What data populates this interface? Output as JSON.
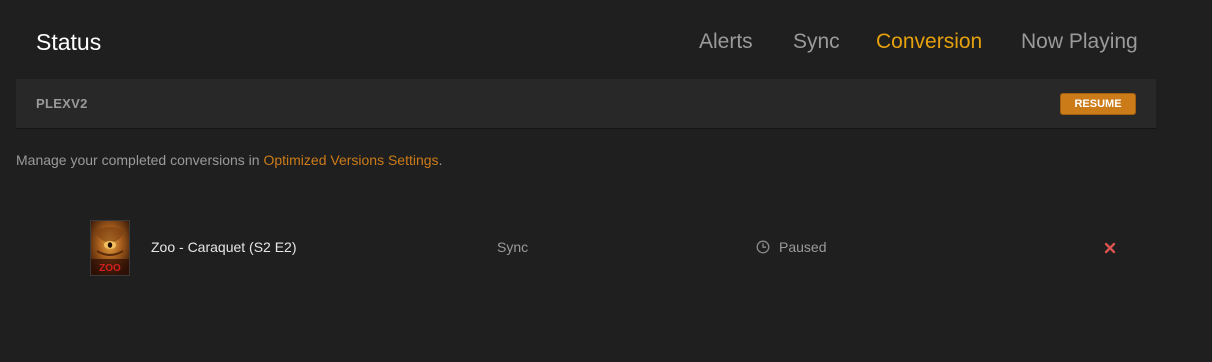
{
  "header": {
    "title": "Status",
    "tabs": [
      {
        "label": "Alerts",
        "active": false
      },
      {
        "label": "Sync",
        "active": false
      },
      {
        "label": "Conversion",
        "active": true
      },
      {
        "label": "Now Playing",
        "active": false
      }
    ]
  },
  "server": {
    "name": "PLEXV2",
    "resume_label": "RESUME"
  },
  "manage": {
    "prefix": "Manage your completed conversions in ",
    "link_text": "Optimized Versions Settings",
    "suffix": "."
  },
  "conversions": [
    {
      "title": "Zoo - Caraquet (S2 E2)",
      "poster_text": "ZOO",
      "type": "Sync",
      "status": "Paused",
      "status_icon": "clock-icon",
      "remove_icon": "close-icon"
    }
  ],
  "colors": {
    "background": "#1f1f1f",
    "accent_active_tab": "#e5a00d",
    "accent_orange": "#cc7b19",
    "remove_red": "#d9534f"
  }
}
